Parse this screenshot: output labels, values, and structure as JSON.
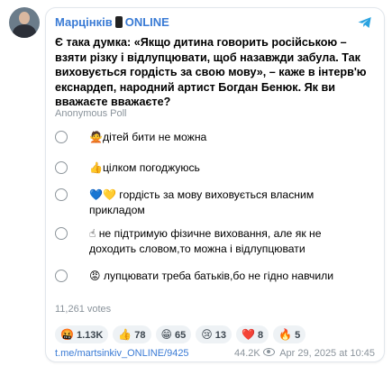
{
  "post": {
    "channel_name_before": "Марцінків",
    "channel_name_after": "ONLINE",
    "text": "Є така думка: «Якщо дитина говорить російською – взяти різку і відлупцювати, щоб назавжди забула. Так виховується гордість за свою мову», – каже в інтерв'ю екснардеп, народний артист Богдан Бенюк. Як ви вважаєте вважаєте?",
    "poll_type": "Anonymous Poll",
    "options": [
      {
        "emoji": "🙅",
        "label": "дітей бити не можна"
      },
      {
        "emoji": "👍",
        "label": "цілком погоджуюсь"
      },
      {
        "emoji": "💙💛",
        "label": "гордість за мову виховується власним прикладом"
      },
      {
        "emoji": "☝",
        "label": "не підтримую фізичне виховання, але як не доходить словом,то можна і відлупцювати"
      },
      {
        "emoji": "😡",
        "label": "лупцювати треба батьків,бо не гідно навчили"
      }
    ],
    "votes": "11,261 votes",
    "reactions": [
      {
        "emoji": "🤬",
        "count": "1.13K"
      },
      {
        "emoji": "👍",
        "count": "78"
      },
      {
        "emoji": "😁",
        "count": "65"
      },
      {
        "emoji": "😢",
        "count": "13"
      },
      {
        "emoji": "❤️",
        "count": "8"
      },
      {
        "emoji": "🔥",
        "count": "5"
      }
    ],
    "link": "t.me/martsinkiv_ONLINE/9425",
    "views": "44.2K",
    "date": "Apr 29, 2025 at 10:45"
  },
  "colors": {
    "accent": "#3a7bd5",
    "muted": "#8a939b",
    "telegram": "#2aa3e0"
  }
}
